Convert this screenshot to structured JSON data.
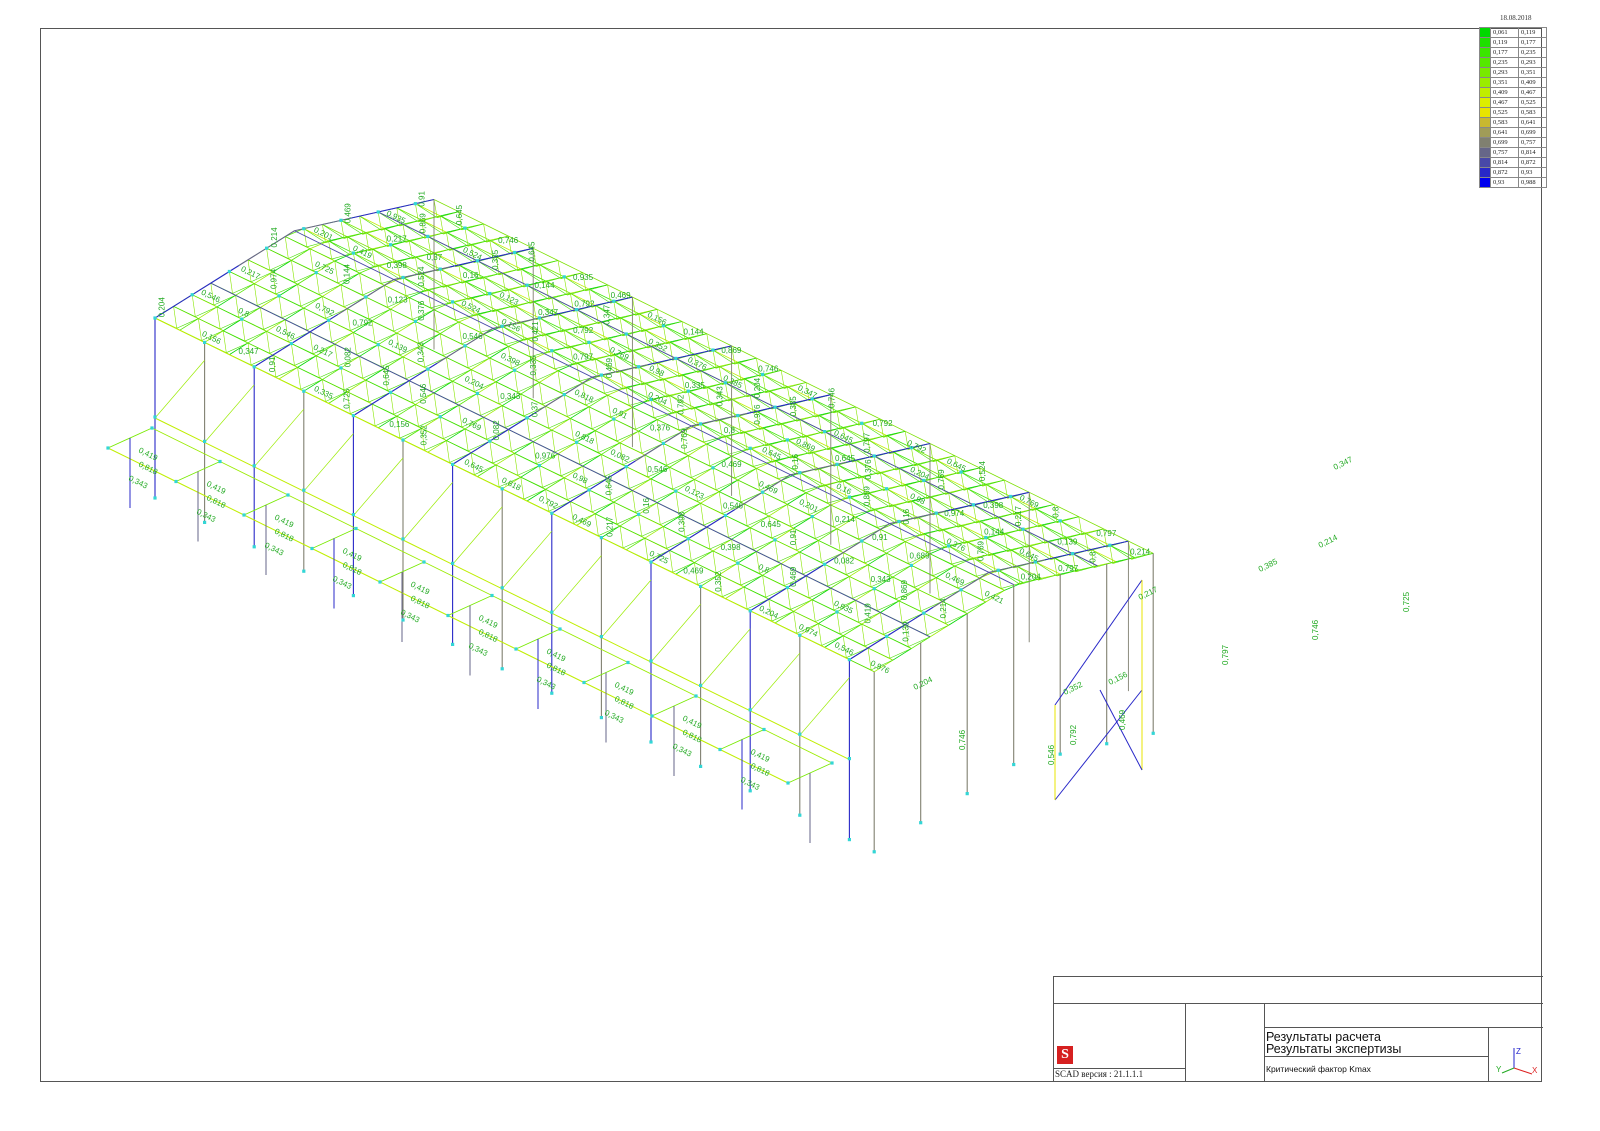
{
  "header": {
    "date": "18.08.2018"
  },
  "legend": {
    "rows": [
      {
        "from": "0,061",
        "to": "0,119",
        "color": "#00d800"
      },
      {
        "from": "0,119",
        "to": "0,177",
        "color": "#1ee000"
      },
      {
        "from": "0,177",
        "to": "0,235",
        "color": "#3ae600"
      },
      {
        "from": "0,235",
        "to": "0,293",
        "color": "#55e800"
      },
      {
        "from": "0,293",
        "to": "0,351",
        "color": "#78ea00"
      },
      {
        "from": "0,351",
        "to": "0,409",
        "color": "#9aec00"
      },
      {
        "from": "0,409",
        "to": "0,467",
        "color": "#c0ee00"
      },
      {
        "from": "0,467",
        "to": "0,525",
        "color": "#dcee00"
      },
      {
        "from": "0,525",
        "to": "0,583",
        "color": "#e8e400"
      },
      {
        "from": "0,583",
        "to": "0,641",
        "color": "#c8b830"
      },
      {
        "from": "0,641",
        "to": "0,699",
        "color": "#a09c58"
      },
      {
        "from": "0,699",
        "to": "0,757",
        "color": "#808070"
      },
      {
        "from": "0,757",
        "to": "0,814",
        "color": "#666688"
      },
      {
        "from": "0,814",
        "to": "0,872",
        "color": "#4848a8"
      },
      {
        "from": "0,872",
        "to": "0,93",
        "color": "#2828c8"
      },
      {
        "from": "0,93",
        "to": "0,988",
        "color": "#0000ee"
      }
    ]
  },
  "model": {
    "member_labels": [
      "0,524",
      "0,082",
      "0,139",
      "0,645",
      "0,123",
      "0,869",
      "0,769",
      "0,689",
      "0,201",
      "0,419",
      "0,818",
      "0,343",
      "0,974",
      "0,725",
      "0,746",
      "0,797",
      "0,546",
      "0,792",
      "0,469",
      "0,352",
      "0,156",
      "0,204",
      "0,217",
      "0,385",
      "0,214",
      "0,347",
      "0,16",
      "0,421",
      "0,144",
      "0,398",
      "0,376",
      "0,335",
      "0,37",
      "0,98",
      "0,976",
      "0,935",
      "0,91",
      "0,8"
    ]
  },
  "title_block": {
    "logo": "S",
    "version": "SCAD версия : 21.1.1.1",
    "title_line1": "Результаты расчета",
    "title_line2": "Результаты экспертизы",
    "subtitle": "Критический фактор Kmax",
    "axes": {
      "z": "Z",
      "y": "Y",
      "x": "X"
    }
  }
}
